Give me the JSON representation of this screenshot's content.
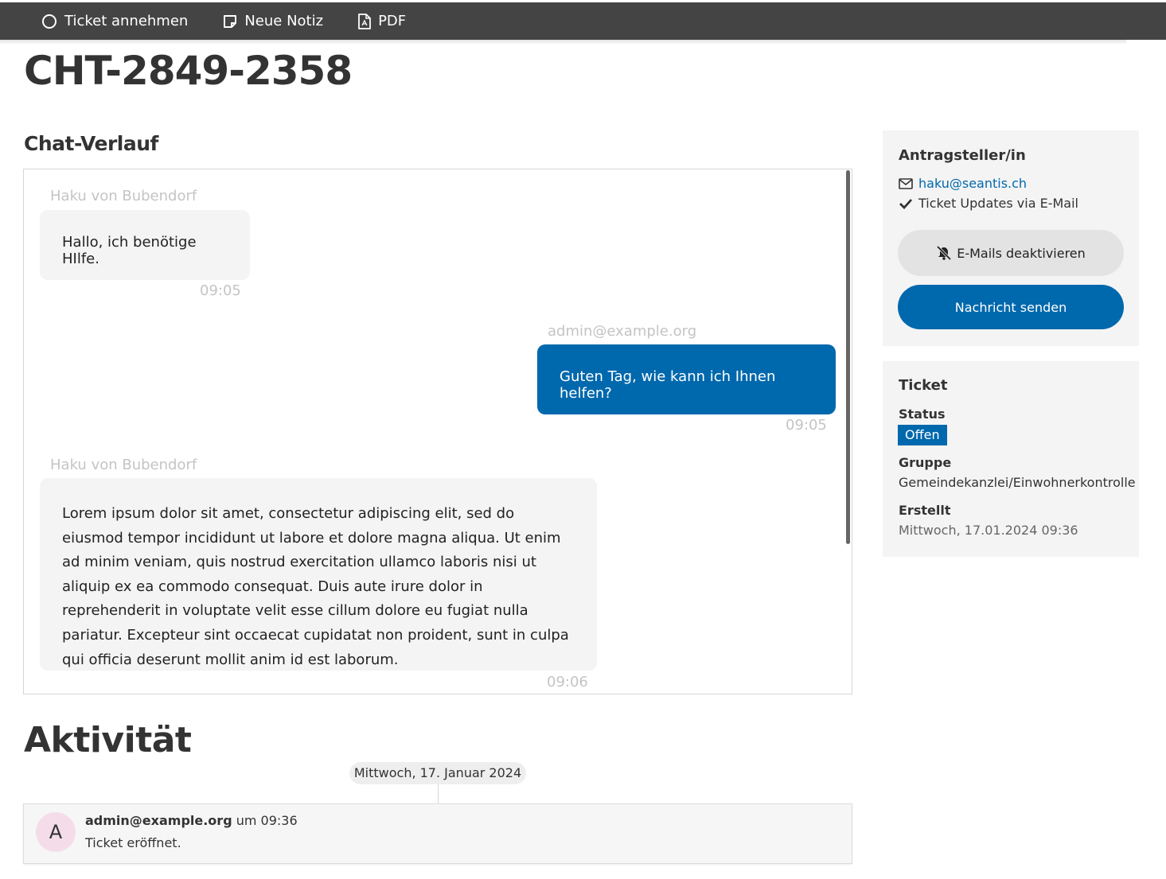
{
  "toolbar": {
    "accept_ticket": "Ticket annehmen",
    "new_note": "Neue Notiz",
    "pdf": "PDF"
  },
  "ticket": {
    "id": "CHT-2849-2358"
  },
  "chat": {
    "title": "Chat-Verlauf",
    "messages": [
      {
        "sender": "Haku von Bubendorf",
        "text": "Hallo, ich benötige HIlfe.",
        "time": "09:05",
        "direction": "incoming"
      },
      {
        "sender": "admin@example.org",
        "text": "Guten Tag, wie kann ich Ihnen helfen?",
        "time": "09:05",
        "direction": "outgoing"
      },
      {
        "sender": "Haku von Bubendorf",
        "text": "Lorem ipsum dolor sit amet, consectetur adipiscing elit, sed do eiusmod tempor incididunt ut labore et dolore magna aliqua. Ut enim ad minim veniam, quis nostrud exercitation ullamco laboris nisi ut aliquip ex ea commodo consequat. Duis aute irure dolor in reprehenderit in voluptate velit esse cillum dolore eu fugiat nulla pariatur. Excepteur sint occaecat cupidatat non proident, sunt in culpa qui officia deserunt mollit anim id est laborum.",
        "time": "09:06",
        "direction": "incoming"
      }
    ]
  },
  "activity": {
    "title": "Aktivität",
    "date": "Mittwoch, 17. Januar 2024",
    "entry": {
      "avatar_letter": "A",
      "user": "admin@example.org",
      "time_text": "um 09:36",
      "message": "Ticket eröffnet."
    }
  },
  "requester": {
    "title": "Antragsteller/in",
    "email": "haku@seantis.ch",
    "updates_text": "Ticket Updates via E-Mail",
    "disable_emails_label": "E-Mails deaktivieren",
    "send_message_label": "Nachricht senden"
  },
  "ticket_info": {
    "title": "Ticket",
    "status_label": "Status",
    "status_value": "Offen",
    "group_label": "Gruppe",
    "group_value": "Gemeindekanzlei/Einwohnerkontrolle",
    "created_label": "Erstellt",
    "created_value": "Mittwoch, 17.01.2024 09:36"
  },
  "colors": {
    "primary": "#0068ad",
    "toolbar": "#444444",
    "bubble_incoming": "#f4f4f4",
    "avatar": "#f4dde9"
  },
  "icons": [
    "circle-icon",
    "note-icon",
    "pdf-icon",
    "envelope-icon",
    "check-icon",
    "bell-slash-icon"
  ]
}
